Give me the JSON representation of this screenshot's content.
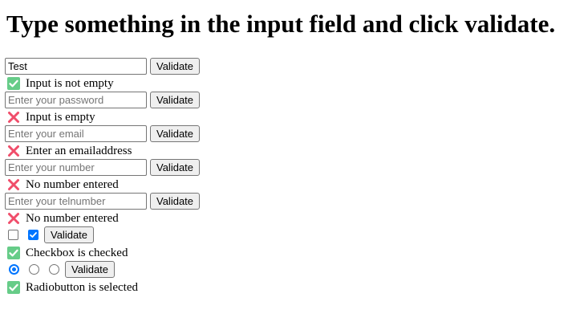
{
  "heading": "Type something in the input field and click validate.",
  "validate_label": "Validate",
  "colors": {
    "success": "#66cc88",
    "error": "#f04d6a",
    "accent": "#0075ff"
  },
  "fields": {
    "text": {
      "value": "Test",
      "placeholder": "",
      "message": "Input is not empty",
      "status": "success"
    },
    "password": {
      "value": "",
      "placeholder": "Enter your password",
      "message": "Input is empty",
      "status": "error"
    },
    "email": {
      "value": "",
      "placeholder": "Enter your email",
      "message": "Enter an emailaddress",
      "status": "error"
    },
    "number": {
      "value": "",
      "placeholder": "Enter your number",
      "message": "No number entered",
      "status": "error"
    },
    "tel": {
      "value": "",
      "placeholder": "Enter your telnumber",
      "message": "No number entered",
      "status": "error"
    }
  },
  "checkboxes": {
    "items": [
      {
        "checked": false
      },
      {
        "checked": true
      }
    ],
    "message": "Checkbox is checked",
    "status": "success"
  },
  "radios": {
    "items": [
      {
        "checked": true
      },
      {
        "checked": false
      },
      {
        "checked": false
      }
    ],
    "message": "Radiobutton is selected",
    "status": "success"
  },
  "icons": {
    "success": "check-mark-icon",
    "error": "cross-mark-icon"
  }
}
